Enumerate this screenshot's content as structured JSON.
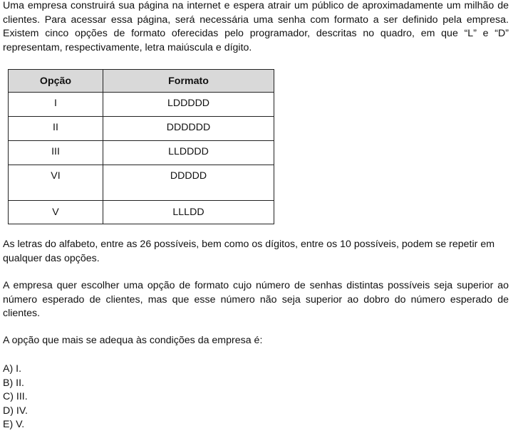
{
  "paragraphs": {
    "intro": "Uma empresa construirá sua página na internet e espera atrair um público de aproximadamente um milhão de clientes. Para acessar essa página, será necessária uma senha com formato a ser definido pela empresa. Existem cinco opções de formato oferecidas pelo programador, descritas no quadro, em que “L” e “D” representam, respectivamente, letra maiúscula e dígito.",
    "repeat": "As letras do alfabeto, entre as 26 possíveis, bem como os dígitos, entre os 10 possíveis, podem se repetir em qualquer das opções.",
    "goal": "A empresa quer escolher uma opção de formato cujo número de senhas distintas possíveis seja superior ao número esperado de clientes, mas que esse número não seja superior ao dobro do número esperado de clientes.",
    "question": "A opção que mais se adequa às condições da empresa é:"
  },
  "table": {
    "headers": [
      "Opção",
      "Formato"
    ],
    "rows": [
      [
        "I",
        "LDDDDD"
      ],
      [
        "II",
        "DDDDDD"
      ],
      [
        "III",
        "LLDDDD"
      ],
      [
        "VI",
        "DDDDD"
      ],
      [
        "V",
        "LLLDD"
      ]
    ]
  },
  "answers": [
    "A) I.",
    "B) II.",
    "C) III.",
    "D) IV.",
    "E) V."
  ]
}
